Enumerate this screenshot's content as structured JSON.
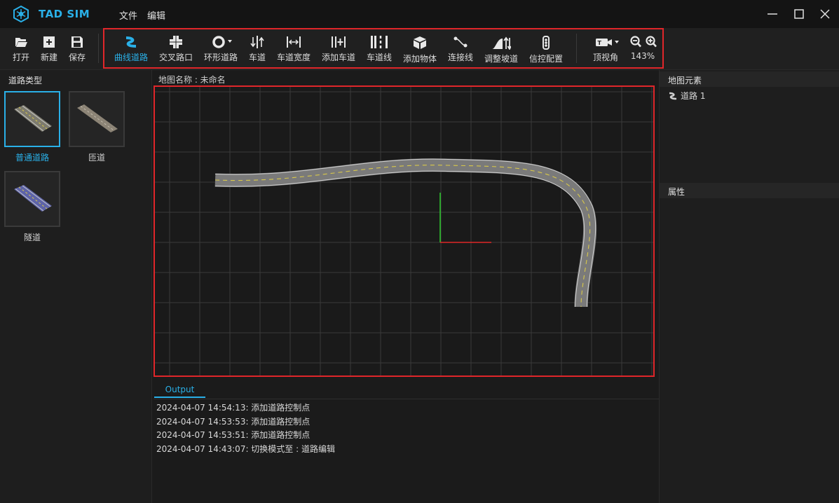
{
  "app": {
    "title": "TAD SIM",
    "menu": [
      "文件",
      "编辑"
    ]
  },
  "toolbar": {
    "file": [
      {
        "label": "打开",
        "icon": "folder-open-icon"
      },
      {
        "label": "新建",
        "icon": "new-file-icon"
      },
      {
        "label": "保存",
        "icon": "save-icon"
      }
    ],
    "tools": [
      {
        "label": "曲线道路",
        "icon": "curve-road-icon",
        "active": true
      },
      {
        "label": "交叉路口",
        "icon": "junction-icon"
      },
      {
        "label": "环形道路",
        "icon": "roundabout-icon",
        "dropdown": true
      },
      {
        "label": "车道",
        "icon": "lane-icon"
      },
      {
        "label": "车道宽度",
        "icon": "lane-width-icon"
      },
      {
        "label": "添加车道",
        "icon": "add-lane-icon"
      },
      {
        "label": "车道线",
        "icon": "lane-line-icon"
      },
      {
        "label": "添加物体",
        "icon": "add-object-icon"
      },
      {
        "label": "连接线",
        "icon": "connect-line-icon"
      },
      {
        "label": "调整坡道",
        "icon": "slope-icon"
      },
      {
        "label": "信控配置",
        "icon": "traffic-light-icon"
      }
    ],
    "view": {
      "label": "顶视角",
      "icon": "camera-icon"
    },
    "zoom": {
      "value": "143%"
    }
  },
  "left_panel": {
    "title": "道路类型",
    "types": [
      {
        "label": "普通道路",
        "selected": true
      },
      {
        "label": "匝道",
        "selected": false
      },
      {
        "label": "隧道",
        "selected": false
      }
    ]
  },
  "canvas": {
    "map_name": "地图名称 : 未命名"
  },
  "output": {
    "tab": "Output",
    "lines": [
      "2024-04-07 14:54:13: 添加道路控制点",
      "2024-04-07 14:53:53: 添加道路控制点",
      "2024-04-07 14:53:51: 添加道路控制点",
      "2024-04-07 14:43:07: 切换模式至 : 道路编辑"
    ]
  },
  "right_panel": {
    "elements_title": "地图元素",
    "elements": [
      {
        "label": "道路 1"
      }
    ],
    "properties_title": "属性"
  },
  "colors": {
    "accent": "#2ab0e8",
    "highlight_box": "#e0262a",
    "road": "#7a7a7a",
    "lane_mark": "#d8c84a"
  }
}
